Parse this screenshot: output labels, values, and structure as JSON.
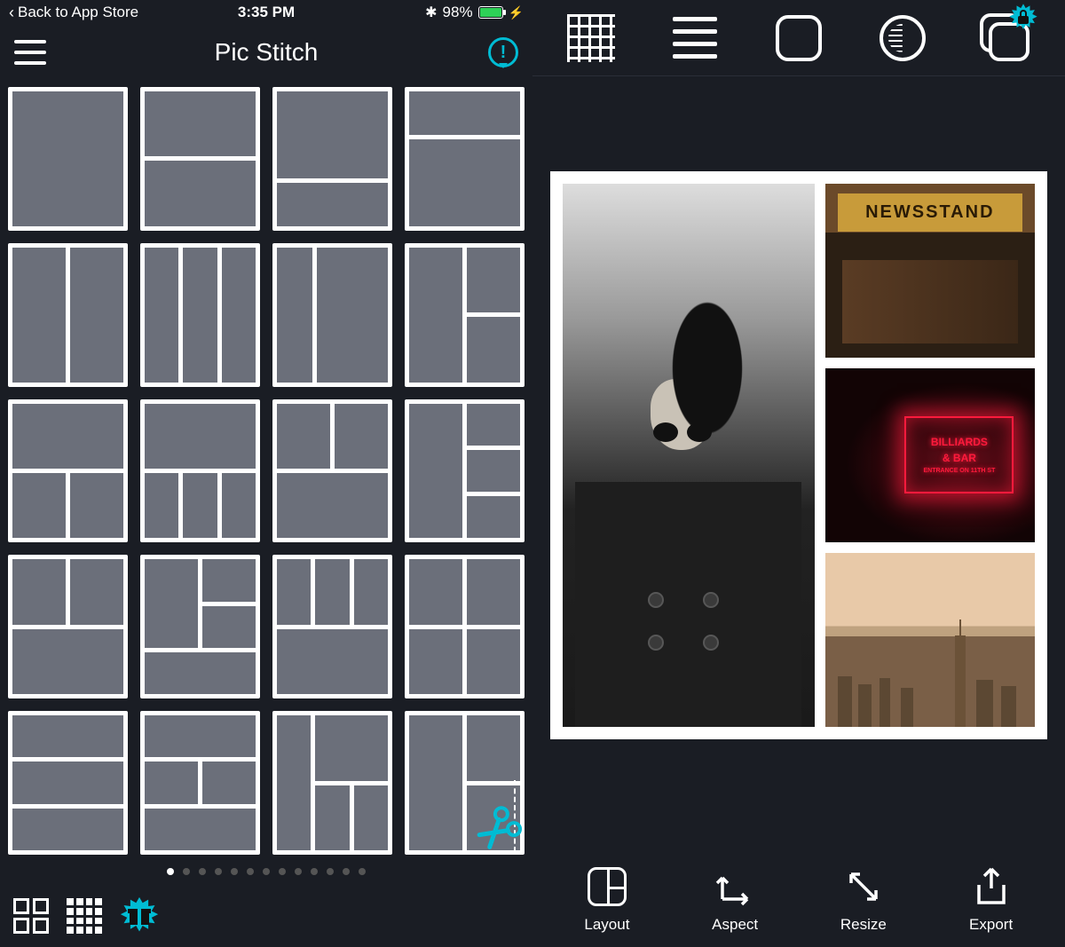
{
  "status": {
    "back_label": "Back to App Store",
    "time": "3:35 PM",
    "battery_percent": "98%"
  },
  "nav": {
    "title": "Pic Stitch"
  },
  "pager": {
    "total": 13,
    "active_index": 0
  },
  "collage": {
    "photo2_sign": "NEWSSTAND",
    "photo3_line1": "BILLIARDS",
    "photo3_line2": "& BAR",
    "photo3_line3": "ENTRANCE ON 11TH ST"
  },
  "bottom_bar": {
    "layout": "Layout",
    "aspect": "Aspect",
    "resize": "Resize",
    "export": "Export"
  },
  "icons": {
    "hamburger": "menu-icon",
    "info": "info-icon",
    "grid_tab": "classic-layouts-icon",
    "mosaic_tab": "fancy-layouts-icon",
    "gift": "gift-icon",
    "grid_tool": "grid-pattern-icon",
    "lines_tool": "border-style-icon",
    "corner_tool": "corner-radius-icon",
    "shadow_tool": "vignette-icon",
    "stack_tool": "layers-icon",
    "lock": "locked-feature-icon",
    "bluetooth": "bluetooth-icon",
    "scissors": "scissors-icon"
  }
}
